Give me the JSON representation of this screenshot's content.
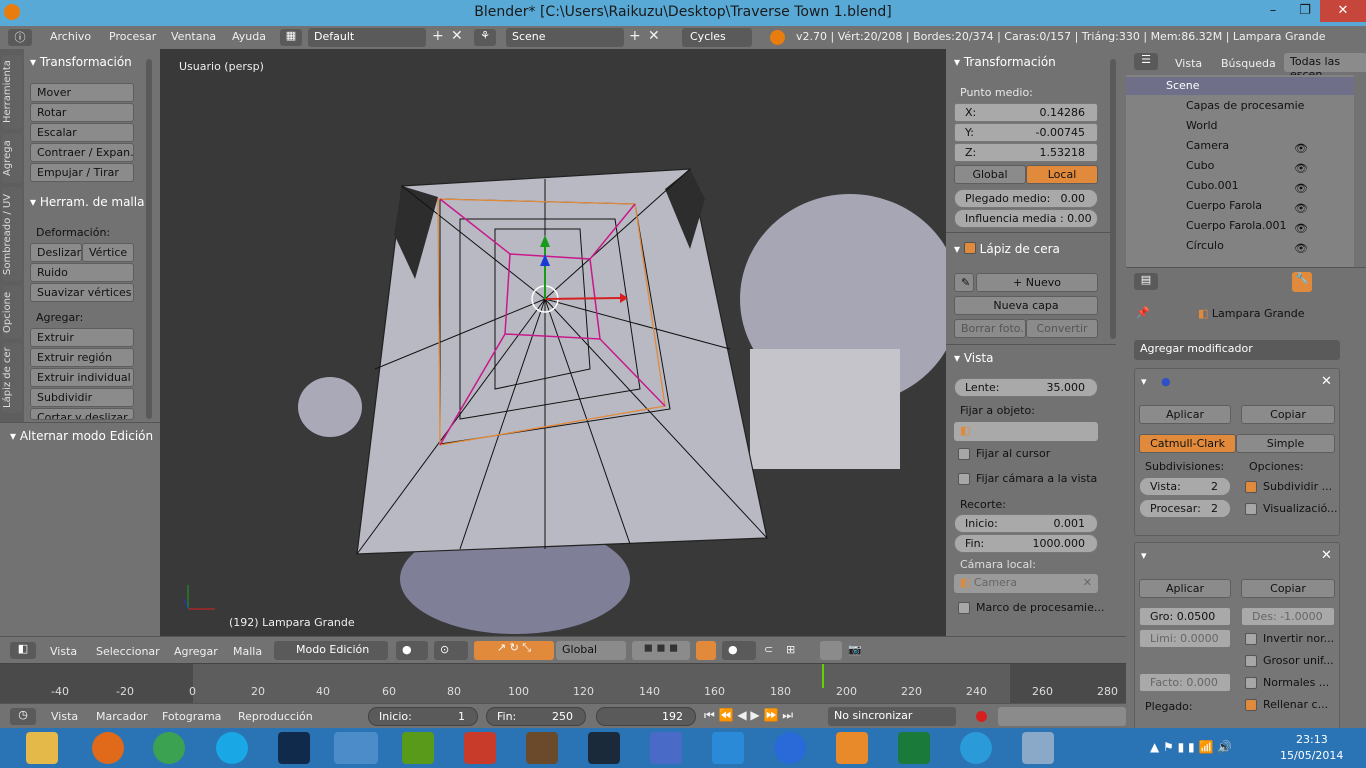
{
  "window": {
    "title": "Blender* [C:\\Users\\Raikuzu\\Desktop\\Traverse Town 1.blend]",
    "min": "–",
    "restore": "❐",
    "close": "✕"
  },
  "infobar": {
    "menus": [
      "Archivo",
      "Procesar",
      "Ventana",
      "Ayuda"
    ],
    "screen_layout": "Default",
    "scene": "Scene",
    "engine": "Cycles",
    "stats": "v2.70 | Vért:20/208 | Bordes:20/374 | Caras:0/157 | Triáng:330 | Mem:86.32M | Lampara Grande"
  },
  "left_tabs": [
    "Herramienta",
    "Agrega",
    "Sombreado / UV",
    "Opcione",
    "Lápiz de cer"
  ],
  "toolshelf": {
    "transform_header": "Transformación",
    "transform_buttons": [
      "Mover",
      "Rotar",
      "Escalar",
      "Contraer / Expan...",
      "Empujar / Tirar"
    ],
    "mesh_tools_header": "Herram. de malla",
    "deform_label": "Deformación:",
    "slide": "Deslizar",
    "vertex": "Vértice",
    "noise": "Ruido",
    "smooth": "Suavizar vértices",
    "add_label": "Agregar:",
    "extrude": "Extruir",
    "extrude_region": "Extruir región",
    "extrude_individual": "Extruir individual",
    "subdivide": "Subdividir",
    "cut_slide": "Cortar y deslizar",
    "toggle_edit": "Alternar modo Edición"
  },
  "viewport": {
    "view_name": "Usuario (persp)",
    "object_label": "(192) Lampara Grande"
  },
  "nprops": {
    "transform_header": "Transformación",
    "median_label": "Punto medio:",
    "x_label": "X:",
    "x": "0.14286",
    "y_label": "Y:",
    "y": "-0.00745",
    "z_label": "Z:",
    "z": "1.53218",
    "global": "Global",
    "local": "Local",
    "crease_label": "Plegado medio:",
    "crease": "0.00",
    "influence": "Influencia media : 0.00",
    "grease_header": "Lápiz de cera",
    "new": "Nuevo",
    "new_layer": "Nueva capa",
    "delete_frame": "Borrar foto...",
    "convert": "Convertir",
    "view_header": "Vista",
    "lens_label": "Lente:",
    "lens": "35.000",
    "lock_label": "Fijar a objeto:",
    "lock_cursor": "Fijar al cursor",
    "lock_camera": "Fijar cámara a la vista",
    "clip_label": "Recorte:",
    "start_label": "Inicio:",
    "start": "0.001",
    "end_label": "Fin:",
    "end": "1000.000",
    "local_cam_label": "Cámara local:",
    "camera": "Camera",
    "render_border": "Marco de procesamie..."
  },
  "outliner": {
    "view": "Vista",
    "search": "Búsqueda",
    "filter": "Todas las escen",
    "items": [
      "Scene",
      "Capas de procesamie",
      "World",
      "Camera",
      "Cubo",
      "Cubo.001",
      "Cuerpo Farola",
      "Cuerpo Farola.001",
      "Círculo"
    ]
  },
  "properties": {
    "object_name": "Lampara Grande",
    "add_modifier": "Agregar modificador",
    "apply": "Aplicar",
    "copy": "Copiar",
    "catmull": "Catmull-Clark",
    "simple": "Simple",
    "subdiv_label": "Subdivisiones:",
    "options_label": "Opciones:",
    "view_label": "Vista:",
    "view_val": "2",
    "render_label": "Procesar:",
    "render_val": "2",
    "subdivide_uvs": "Subdividir ...",
    "optimal": "Visualizació...",
    "apply2": "Aplicar",
    "copy2": "Copiar",
    "thickness": "Gro: 0.0500",
    "offset": "Des: -1.0000",
    "limit": "Limi: 0.0000",
    "invert": "Invertir nor...",
    "even": "Grosor unif...",
    "factor": "Facto: 0.000",
    "normals": "Normales ...",
    "crease": "Plegado:",
    "fill": "Rellenar c..."
  },
  "viewport_header": {
    "view": "Vista",
    "select": "Seleccionar",
    "add": "Agregar",
    "mesh": "Malla",
    "mode": "Modo Edición",
    "orientation": "Global"
  },
  "timeline": {
    "ticks": [
      "-40",
      "-20",
      "0",
      "20",
      "40",
      "60",
      "80",
      "100",
      "120",
      "140",
      "160",
      "180",
      "200",
      "220",
      "240",
      "260",
      "280"
    ],
    "view": "Vista",
    "marker": "Marcador",
    "frame": "Fotograma",
    "playback": "Reproducción",
    "start_label": "Inicio:",
    "start": "1",
    "end_label": "Fin:",
    "end": "250",
    "current": "192",
    "sync": "No sincronizar"
  },
  "taskbar": {
    "time": "23:13",
    "date": "15/05/2014"
  },
  "colors": {
    "accent": "#e18a3b",
    "titlebar": "#59a9d6",
    "taskbar": "#2a74b5"
  }
}
